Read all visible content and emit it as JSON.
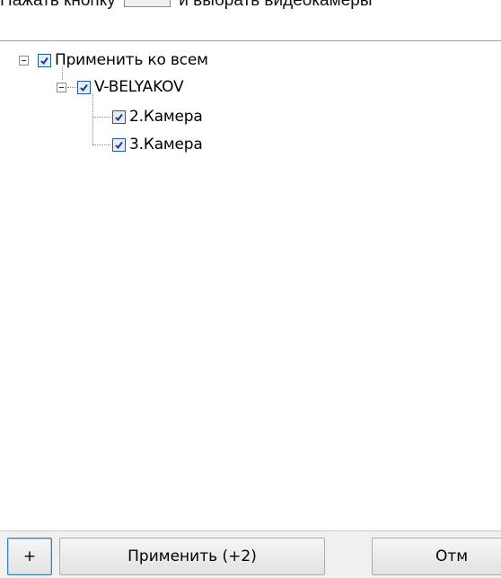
{
  "instruction": {
    "before": "Нажать кнопку",
    "after": "и выбрать видеокамеры"
  },
  "tree": {
    "root": {
      "label": "Применить ко всем",
      "expanded": true,
      "checked": true
    },
    "server": {
      "label": "V-BELYAKOV",
      "expanded": true,
      "checked": true
    },
    "cameras": [
      {
        "label": "2.Камера",
        "checked": true
      },
      {
        "label": "3.Камера",
        "checked": true
      }
    ]
  },
  "footer": {
    "add_label": "+",
    "apply_label": "Применить (+2)",
    "cancel_label": "Отм"
  },
  "icons": {
    "expander": "minus-box-icon",
    "checkbox": "checkmark-icon"
  },
  "colors": {
    "checkbox_border": "#1e5a9c",
    "checkmark": "#1d3f77",
    "focus_border": "#3c7fb1"
  }
}
